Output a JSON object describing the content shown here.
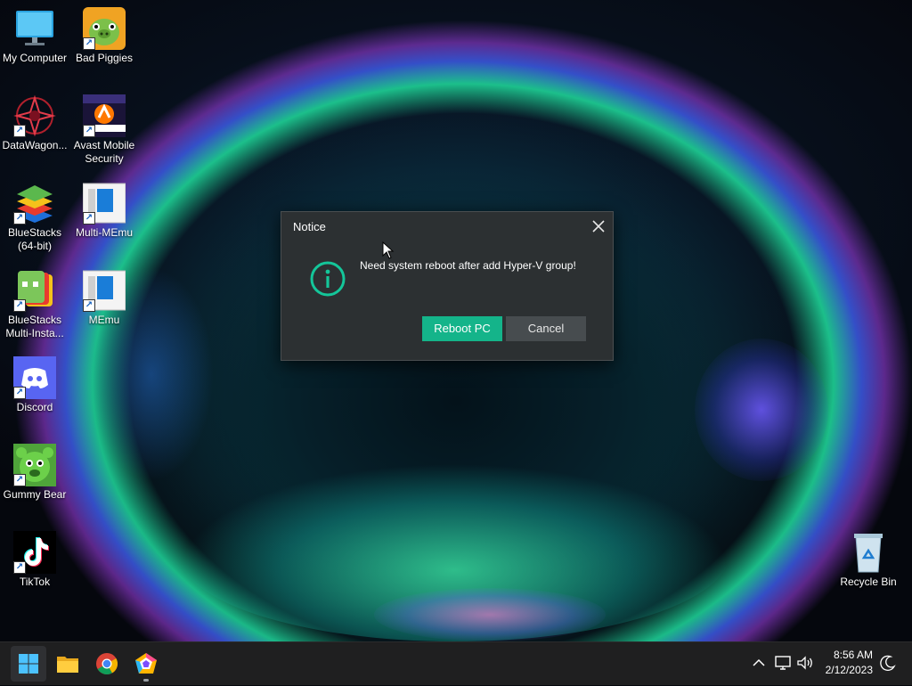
{
  "dialog": {
    "title": "Notice",
    "message": "Need system reboot after add Hyper-V group!",
    "primary_button": "Reboot PC",
    "secondary_button": "Cancel",
    "accent_color": "#14b48a"
  },
  "desktop": {
    "icons": [
      {
        "label": "My Computer",
        "icon": "monitor-icon"
      },
      {
        "label": "Bad Piggies",
        "icon": "bad-piggies-icon",
        "shortcut": true
      },
      {
        "label": "DataWagon...",
        "icon": "datawagon-icon",
        "shortcut": true
      },
      {
        "label": "Avast Mobile Security",
        "icon": "avast-icon",
        "shortcut": true
      },
      {
        "label": "BlueStacks (64-bit)",
        "icon": "bluestacks-icon",
        "shortcut": true
      },
      {
        "label": "Multi-MEmu",
        "icon": "memu-icon",
        "shortcut": true
      },
      {
        "label": "BlueStacks Multi-Insta...",
        "icon": "bluestacks-multi-icon",
        "shortcut": true
      },
      {
        "label": "MEmu",
        "icon": "memu-icon",
        "shortcut": true
      },
      {
        "label": "Discord",
        "icon": "discord-icon",
        "shortcut": true
      },
      {
        "label": "Gummy Bear",
        "icon": "gummy-bear-icon",
        "shortcut": true
      },
      {
        "label": "TikTok",
        "icon": "tiktok-icon",
        "shortcut": true
      },
      {
        "label": "Recycle Bin",
        "icon": "recycle-bin-icon"
      }
    ]
  },
  "taskbar": {
    "apps": [
      "start-icon",
      "file-explorer-icon",
      "chrome-icon",
      "app-icon"
    ],
    "time": "8:56 AM",
    "date": "2/12/2023"
  }
}
